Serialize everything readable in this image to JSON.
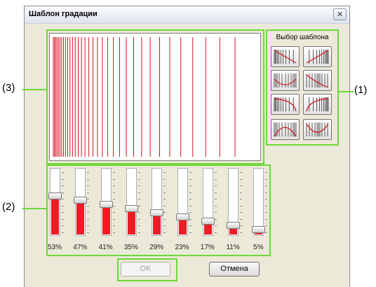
{
  "window": {
    "title": "Шаблон градации",
    "close_glyph": "✕"
  },
  "pattern_panel": {
    "title": "Выбор шаблона",
    "buttons": [
      "pattern-1",
      "pattern-2",
      "pattern-3",
      "pattern-4",
      "pattern-5",
      "pattern-6",
      "pattern-7",
      "pattern-8"
    ]
  },
  "sliders": [
    {
      "label": "53%",
      "value": 53
    },
    {
      "label": "47%",
      "value": 47
    },
    {
      "label": "41%",
      "value": 41
    },
    {
      "label": "35%",
      "value": 35
    },
    {
      "label": "29%",
      "value": 29
    },
    {
      "label": "23%",
      "value": 23
    },
    {
      "label": "17%",
      "value": 17
    },
    {
      "label": "11%",
      "value": 11
    },
    {
      "label": "5%",
      "value": 5
    }
  ],
  "buttons": {
    "ok": "OK",
    "cancel": "Отмена"
  },
  "callouts": {
    "one": "(1)",
    "two": "(2)",
    "three": "(3)"
  },
  "colors": {
    "accent": "#6dd93a",
    "line": "#d4141c",
    "fill": "#ee1c25",
    "dialog": "#ece9d8"
  }
}
